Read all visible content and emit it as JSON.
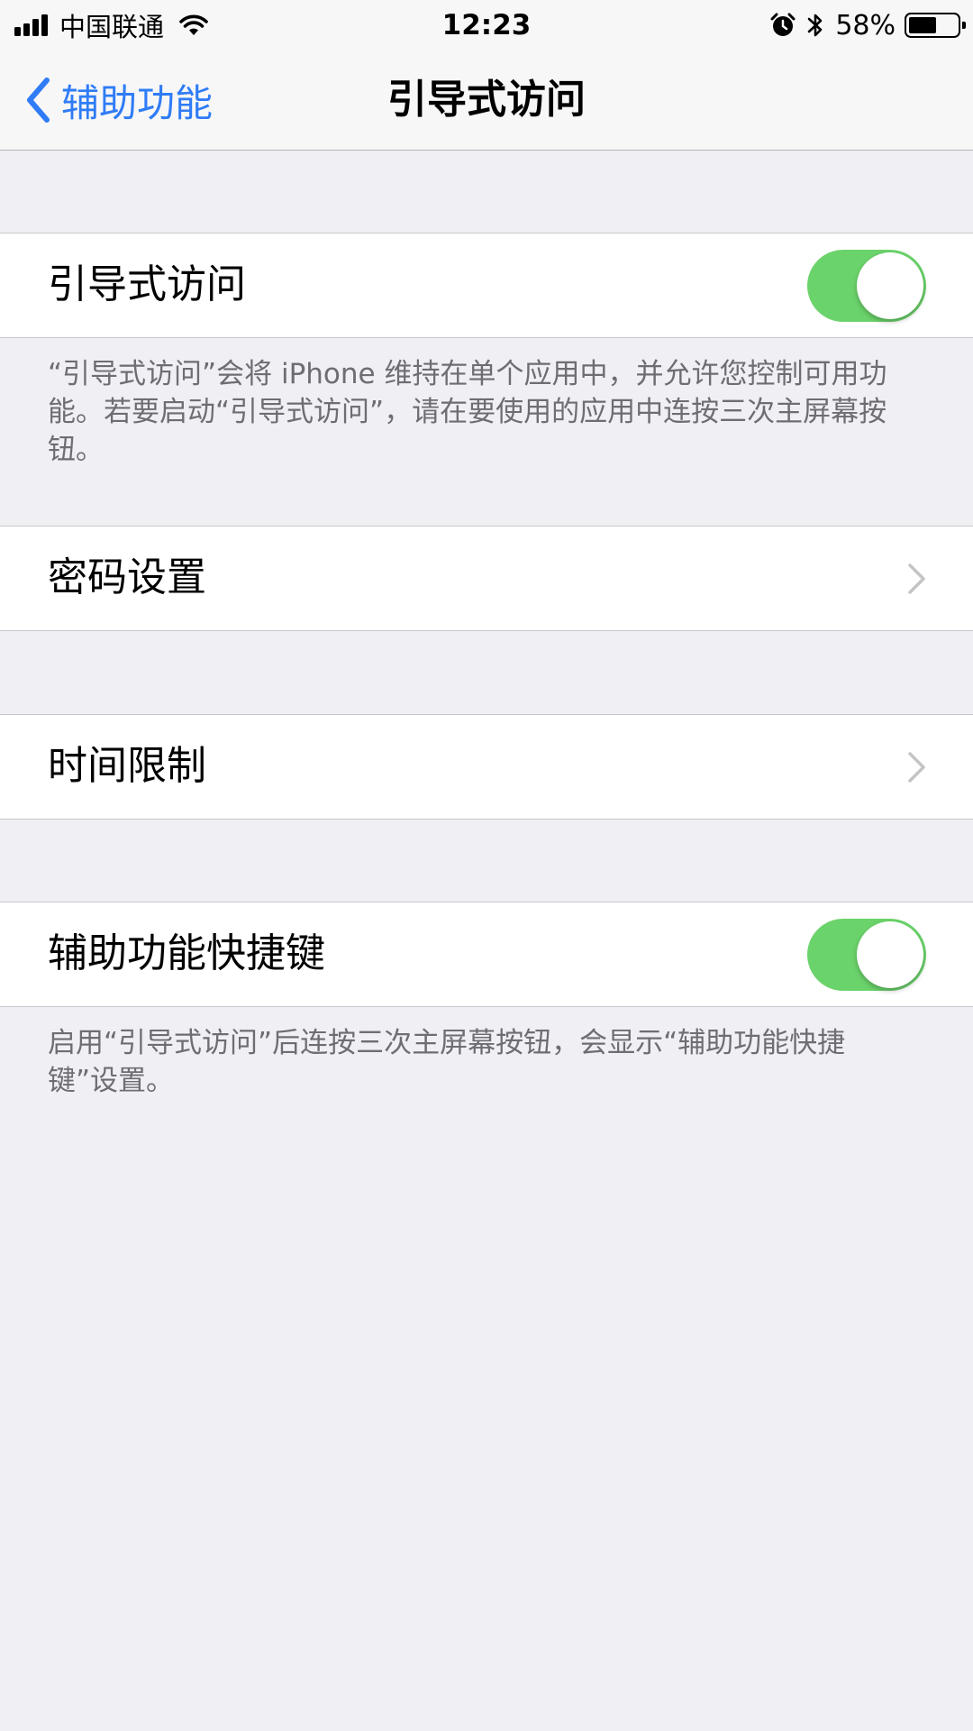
{
  "status_bar": {
    "carrier": "中国联通",
    "time": "12:23",
    "battery_percent": "58%",
    "battery_level": 0.58,
    "icons": [
      "signal-icon",
      "wifi-icon",
      "alarm-icon",
      "bluetooth-icon",
      "battery-icon"
    ]
  },
  "nav": {
    "back_label": "辅助功能",
    "title": "引导式访问"
  },
  "colors": {
    "accent": "#2f7cf6",
    "toggle_on": "#6bd36b",
    "background": "#efeff4",
    "footnote": "#6d6d72"
  },
  "guided_access": {
    "label": "引导式访问",
    "enabled": true,
    "footnote": "“引导式访问”会将 iPhone 维持在单个应用中，并允许您控制可用功能。若要启动“引导式访问”，请在要使用的应用中连按三次主屏幕按钮。"
  },
  "passcode_settings": {
    "label": "密码设置"
  },
  "time_limits": {
    "label": "时间限制"
  },
  "accessibility_shortcut": {
    "label": "辅助功能快捷键",
    "enabled": true,
    "footnote": "启用“引导式访问”后连按三次主屏幕按钮，会显示“辅助功能快捷键”设置。"
  }
}
